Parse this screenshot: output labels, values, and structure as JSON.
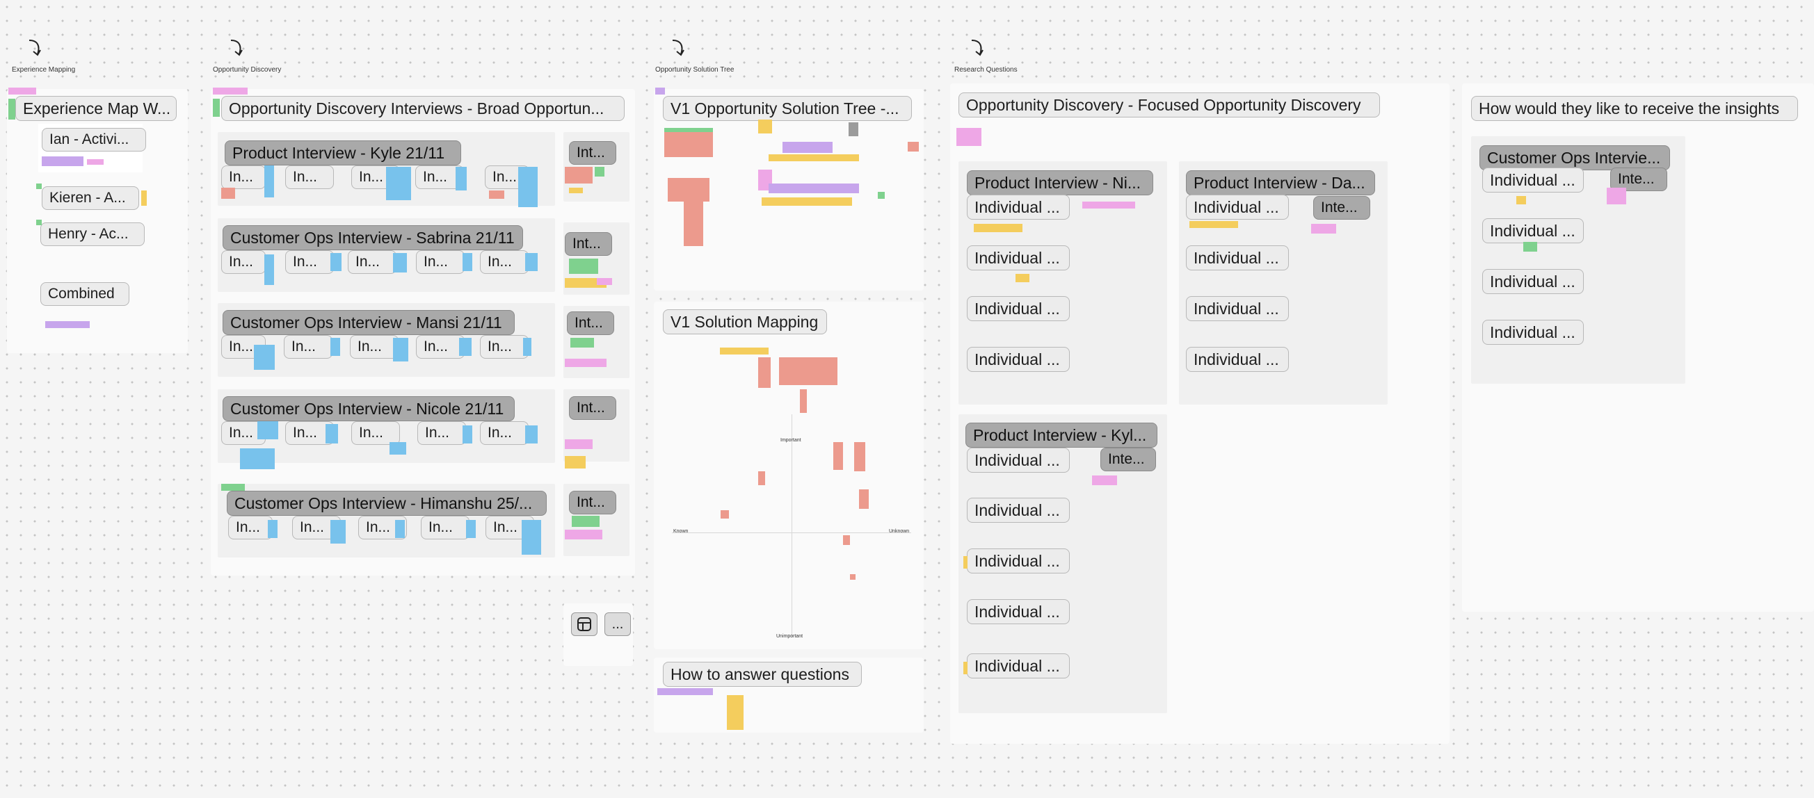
{
  "sections": {
    "experience_mapping": "Experience Mapping",
    "opportunity_discovery": "Opportunity Discovery",
    "opportunity_solution_tree": "Opportunity Solution Tree",
    "research_questions": "Research Questions"
  },
  "experience": {
    "main": "Experience Map W...",
    "ian": "Ian - Activi...",
    "kieren": "Kieren - A...",
    "henry": "Henry - Ac...",
    "combined": "Combined"
  },
  "discovery": {
    "main": "Opportunity Discovery Interviews - Broad Opportun...",
    "rows": [
      {
        "title": "Product Interview - Kyle  21/11",
        "side": "Int..."
      },
      {
        "title": "Customer Ops Interview - Sabrina 21/11",
        "side": "Int..."
      },
      {
        "title": "Customer Ops Interview - Mansi 21/11",
        "side": "Int..."
      },
      {
        "title": "Customer Ops Interview - Nicole 21/11",
        "side": "Int..."
      },
      {
        "title": "Customer Ops Interview - Himanshu 25/...",
        "side": "Int..."
      }
    ],
    "cell": "In..."
  },
  "tree": {
    "v1_tree": "V1 Opportunity Solution Tree -...",
    "v1_mapping": "V1 Solution Mapping",
    "how_to": "How to answer questions",
    "axis": {
      "important": "Important",
      "unimportant": "Unimportant",
      "known": "Known",
      "unknown": "Unknown"
    }
  },
  "focused": {
    "main": "Opportunity Discovery - Focused Opportunity Discovery",
    "prod_ni": "Product Interview - Ni...",
    "prod_da": "Product Interview - Da...",
    "prod_kyl": "Product Interview - Kyl...",
    "inte": "Inte...",
    "individual": "Individual ..."
  },
  "insights": {
    "main": "How would they like to receive the insights",
    "cust_ops": "Customer Ops Intervie...",
    "inte": "Inte...",
    "individual": "Individual ..."
  },
  "toolbar": {
    "layout_icon": "layout-icon",
    "more_label": "..."
  }
}
